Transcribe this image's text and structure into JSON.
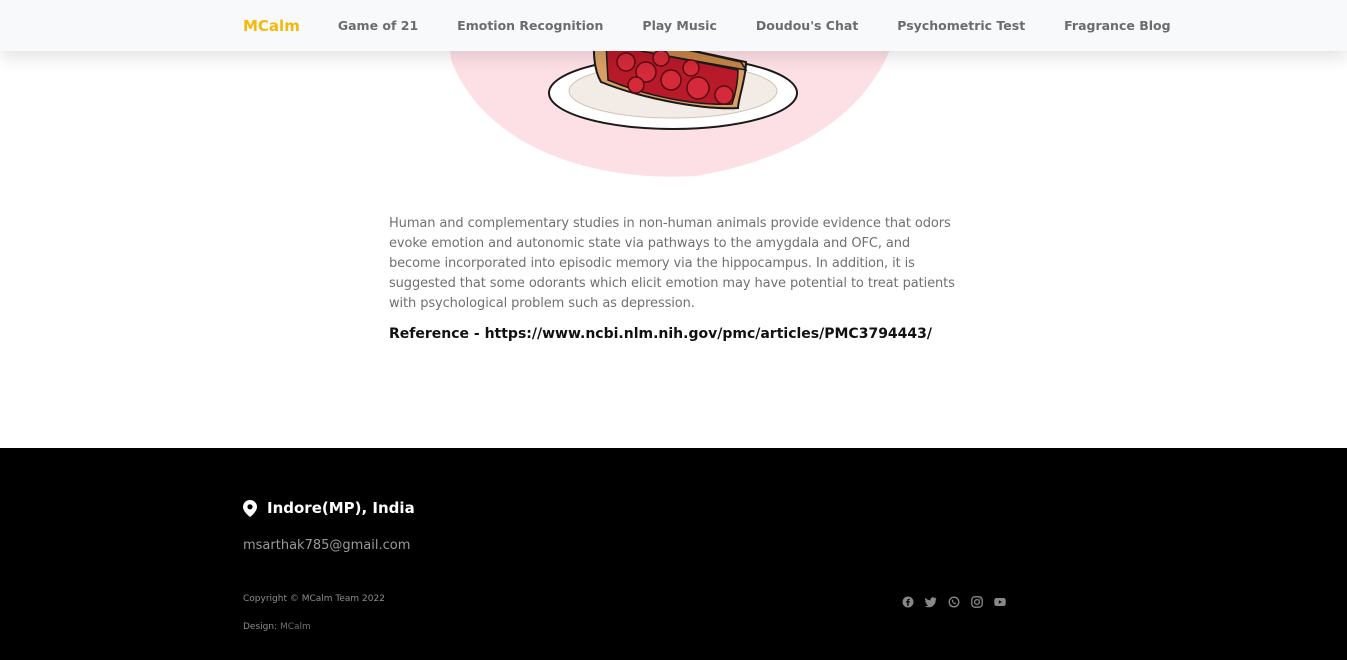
{
  "nav": {
    "brand": "MCalm",
    "links": [
      "Game of 21",
      "Emotion Recognition",
      "Play Music",
      "Doudou's Chat",
      "Psychometric Test",
      "Fragrance Blog"
    ]
  },
  "article": {
    "paragraph": "Human and complementary studies in non-human animals provide evidence that odors evoke emotion and autonomic state via pathways to the amygdala and OFC, and become incorporated into episodic memory via the hippocampus. In addition, it is suggested that some odorants which elicit emotion may have potential to treat patients with psychological problem such as depression.",
    "reference": "Reference - https://www.ncbi.nlm.nih.gov/pmc/articles/PMC3794443/"
  },
  "footer": {
    "location": "Indore(MP), India",
    "email": "msarthak785@gmail.com",
    "copyright": "Copyright © MCalm Team 2022",
    "design_label": "Design:",
    "design_brand": "MCalm",
    "social_icons": [
      "facebook-icon",
      "twitter-icon",
      "whatsapp-icon",
      "instagram-icon",
      "youtube-icon"
    ]
  },
  "colors": {
    "brand": "#f5b90a",
    "footer_bg": "#000000",
    "nav_bg": "#f8f9fa",
    "pink_blob": "#fde0e6"
  }
}
